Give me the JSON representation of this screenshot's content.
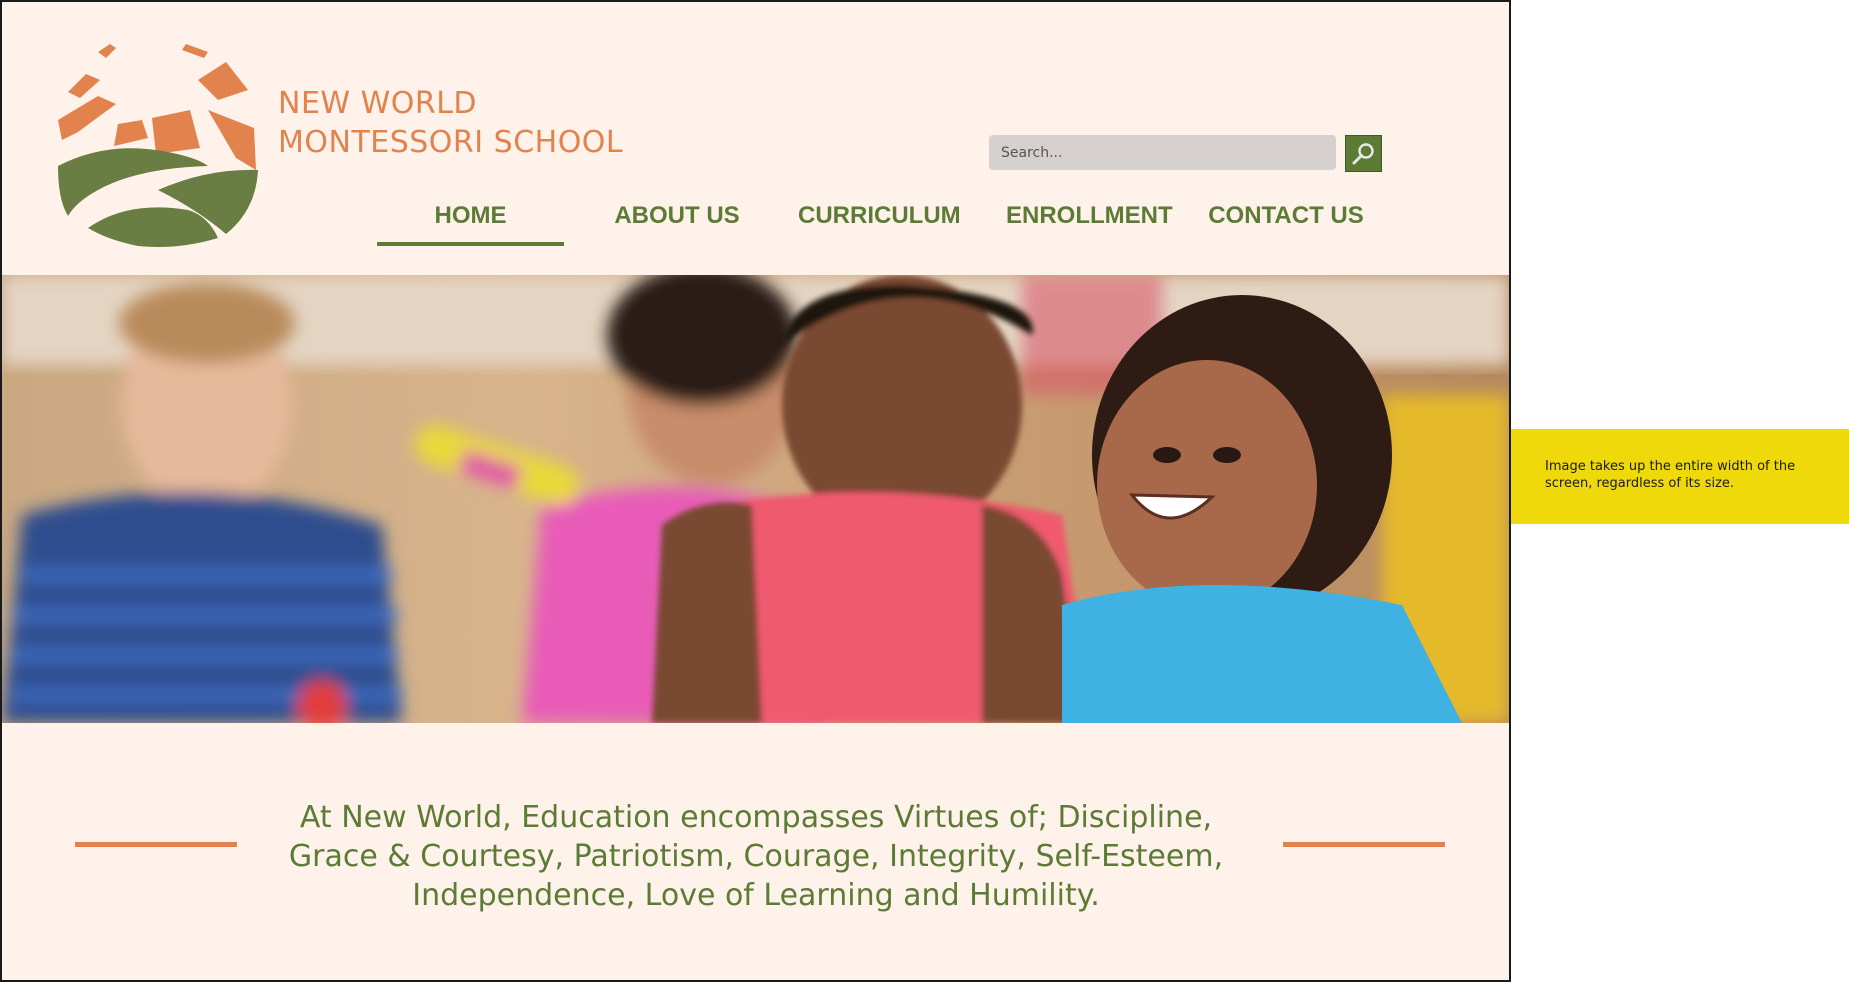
{
  "brand": {
    "line1": "NEW WORLD",
    "line2": "MONTESSORI SCHOOL"
  },
  "search": {
    "placeholder": "Search..."
  },
  "nav": {
    "items": [
      {
        "label": "HOME",
        "active": true
      },
      {
        "label": "ABOUT US",
        "active": false
      },
      {
        "label": "CURRICULUM",
        "active": false
      },
      {
        "label": "ENROLLMENT",
        "active": false
      },
      {
        "label": "CONTACT US",
        "active": false
      }
    ]
  },
  "hero": {
    "image": "photo of smiling children in a classroom"
  },
  "quote": {
    "line1": "At New World, Education encompasses Virtues of; Discipline,",
    "line2": "Grace & Courtesy, Patriotism, Courage, Integrity, Self-Esteem,",
    "line3": "Independence, Love of Learning and Humility."
  },
  "annotation": {
    "text": "Image takes up the entire width of the screen, regardless of its size."
  },
  "colors": {
    "background": "#fff2ea",
    "accent_orange": "#e2824c",
    "accent_green": "#5c7b35",
    "note_yellow": "#f0d90b"
  },
  "icons": {
    "search_button": "magnifier-icon",
    "logo": "sunrise-hills-logo-icon"
  }
}
